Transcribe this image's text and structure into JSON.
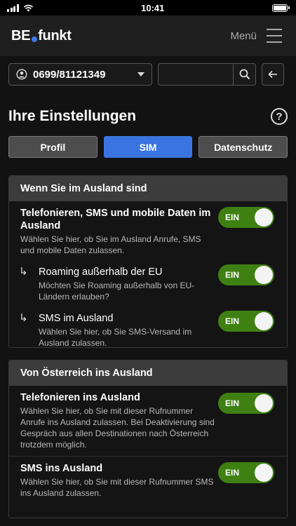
{
  "status_bar": {
    "time": "10:41"
  },
  "header": {
    "logo_left": "BE",
    "logo_right": "funkt",
    "menu_label": "Menü"
  },
  "account": {
    "number": "0699/81121349"
  },
  "search": {
    "value": "",
    "placeholder": ""
  },
  "page": {
    "title": "Ihre Einstellungen",
    "help": "?"
  },
  "tabs": [
    {
      "label": "Profil"
    },
    {
      "label": "SIM"
    },
    {
      "label": "Datenschutz"
    }
  ],
  "sections": [
    {
      "title": "Wenn Sie im Ausland sind",
      "items": [
        {
          "title": "Telefonieren, SMS und mobile Daten im Ausland",
          "desc": "Wählen Sie hier, ob Sie im Ausland Anrufe, SMS und mobile Daten zulassen.",
          "toggle": "EIN"
        },
        {
          "title": "Roaming außerhalb der EU",
          "desc": "Möchten Sie Roaming außerhalb von EU-Ländern erlauben?",
          "toggle": "EIN"
        },
        {
          "title": "SMS im Ausland",
          "desc": "Wählen Sie hier, ob Sie SMS-Versand im Ausland zulassen.",
          "toggle": "EIN"
        }
      ]
    },
    {
      "title": "Von Österreich ins Ausland",
      "items": [
        {
          "title": "Telefonieren ins Ausland",
          "desc": "Wählen Sie hier, ob Sie mit dieser Rufnummer Anrufe ins Ausland zulassen. Bei Deaktivierung sind Gespräch aus allen Destinationen nach Österreich trotzdem möglich.",
          "toggle": "EIN"
        },
        {
          "title": "SMS ins Ausland",
          "desc": "Wählen Sie hier, ob Sie mit dieser Rufnummer SMS ins Ausland zulassen.",
          "toggle": "EIN"
        }
      ]
    }
  ],
  "icons": {
    "account": "user-circle-icon",
    "dropdown": "caret-down-icon",
    "search": "search-icon",
    "back": "arrow-left-icon",
    "help": "help-icon",
    "sub_item": "sub-arrow-icon",
    "menu": "hamburger-icon"
  },
  "colors": {
    "accent": "#3a74e0",
    "toggle_on": "#3f8012",
    "header_bg": "#1f1f1f",
    "background": "#121212"
  }
}
